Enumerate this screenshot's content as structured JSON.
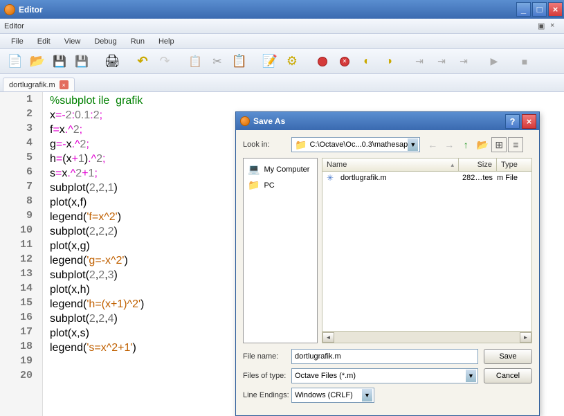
{
  "titlebar": {
    "title": "Editor"
  },
  "subTitle": {
    "title": "Editor"
  },
  "menu": {
    "file": "File",
    "edit": "Edit",
    "view": "View",
    "debug": "Debug",
    "run": "Run",
    "help": "Help"
  },
  "tab": {
    "filename": "dortlugrafik.m"
  },
  "code": {
    "l1": {
      "a": "%subplot ile  grafik"
    },
    "l2": {
      "a": "x",
      "b": "=-",
      "c": "2",
      "d": ":",
      "e": "0.1",
      "f": ":",
      "g": "2",
      "h": ";"
    },
    "l3": {
      "a": "f",
      "b": "=",
      "c": "x",
      "d": ".^",
      "e": "2",
      "f": ";"
    },
    "l4": {
      "a": "g",
      "b": "=-",
      "c": "x",
      "d": ".^",
      "e": "2",
      "f": ";"
    },
    "l5": {
      "a": "h",
      "b": "=",
      "c": "(",
      "d": "x",
      "e": "+",
      "f": "1",
      "g": ")",
      "h": ".^",
      "i": "2",
      "j": ";"
    },
    "l6": {
      "a": "s",
      "b": "=",
      "c": "x",
      "d": ".^",
      "e": "2",
      "f": "+",
      "g": "1",
      "h": ";"
    },
    "l7": {
      "a": "subplot",
      "b": "(",
      "c": "2",
      "d": ",",
      "e": "2",
      "f": ",",
      "g": "1",
      "h": ")"
    },
    "l8": {
      "a": "plot",
      "b": "(",
      "c": "x",
      "d": ",",
      "e": "f",
      "f": ")"
    },
    "l9": {
      "a": "legend",
      "b": "(",
      "c": "'f=x^2'",
      "d": ")"
    },
    "l10": {
      "a": "subplot",
      "b": "(",
      "c": "2",
      "d": ",",
      "e": "2",
      "f": ",",
      "g": "2",
      "h": ")"
    },
    "l11": {
      "a": "plot",
      "b": "(",
      "c": "x",
      "d": ",",
      "e": "g",
      "f": ")"
    },
    "l12": {
      "a": "legend",
      "b": "(",
      "c": "'g=-x^2'",
      "d": ")"
    },
    "l13": {
      "a": "subplot",
      "b": "(",
      "c": "2",
      "d": ",",
      "e": "2",
      "f": ",",
      "g": "3",
      "h": ")"
    },
    "l14": {
      "a": "plot",
      "b": "(",
      "c": "x",
      "d": ",",
      "e": "h",
      "f": ")"
    },
    "l15": {
      "a": "legend",
      "b": "(",
      "c": "'h=(x+1)^2'",
      "d": ")"
    },
    "l16": {
      "a": "subplot",
      "b": "(",
      "c": "2",
      "d": ",",
      "e": "2",
      "f": ",",
      "g": "4",
      "h": ")"
    },
    "l17": {
      "a": "plot",
      "b": "(",
      "c": "x",
      "d": ",",
      "e": "s",
      "f": ")"
    },
    "l18": {
      "a": "legend",
      "b": "(",
      "c": "'s=x^2+1'",
      "d": ")"
    }
  },
  "lineNumbers": [
    "1",
    "2",
    "3",
    "4",
    "5",
    "6",
    "7",
    "8",
    "9",
    "10",
    "11",
    "12",
    "13",
    "14",
    "15",
    "16",
    "17",
    "18",
    "19",
    "20"
  ],
  "dialog": {
    "title": "Save As",
    "lookInLabel": "Look in:",
    "lookInPath": "C:\\Octave\\Oc...0.3\\mathesap",
    "sidebar": {
      "mycomputer": "My Computer",
      "pc": "PC"
    },
    "columns": {
      "name": "Name",
      "size": "Size",
      "type": "Type"
    },
    "rows": [
      {
        "name": "dortlugrafik.m",
        "size": "282…tes",
        "type": "m File"
      }
    ],
    "filenameLabel": "File name:",
    "filenameValue": "dortlugrafik.m",
    "typeLabel": "Files of type:",
    "typeValue": "Octave Files (*.m)",
    "lineEndLabel": "Line Endings:",
    "lineEndValue": "Windows (CRLF)",
    "saveBtn": "Save",
    "cancelBtn": "Cancel"
  }
}
